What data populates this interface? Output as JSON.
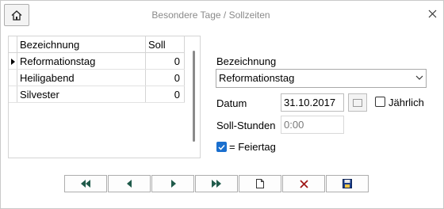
{
  "window": {
    "title": "Besondere Tage / Sollzeiten",
    "home_icon": "home-icon",
    "close_icon": "close-icon"
  },
  "grid": {
    "columns": [
      "Bezeichnung",
      "Soll"
    ],
    "rows": [
      {
        "name": "Reformationstag",
        "soll": "0",
        "current": true
      },
      {
        "name": "Heiligabend",
        "soll": "0",
        "current": false
      },
      {
        "name": "Silvester",
        "soll": "0",
        "current": false
      }
    ]
  },
  "form": {
    "bezeichnung_label": "Bezeichnung",
    "bezeichnung_value": "Reformationstag",
    "datum_label": "Datum",
    "datum_value": "31.10.2017",
    "jaehrlich_label": "Jährlich",
    "jaehrlich_checked": false,
    "soll_stunden_label": "Soll-Stunden",
    "soll_stunden_value": "0:00",
    "feiertag_label": "= Feiertag",
    "feiertag_checked": true
  },
  "toolbar": {
    "buttons": [
      {
        "name": "first-record",
        "icon": "double-left-icon"
      },
      {
        "name": "previous-record",
        "icon": "left-icon"
      },
      {
        "name": "next-record",
        "icon": "right-icon"
      },
      {
        "name": "last-record",
        "icon": "double-right-icon"
      },
      {
        "name": "new-record",
        "icon": "new-document-icon"
      },
      {
        "name": "delete-record",
        "icon": "delete-x-icon"
      },
      {
        "name": "save-record",
        "icon": "save-disk-icon"
      }
    ]
  },
  "colors": {
    "accent": "#1a6fce",
    "nav_arrow": "#1f5a4a",
    "delete": "#a01818"
  }
}
